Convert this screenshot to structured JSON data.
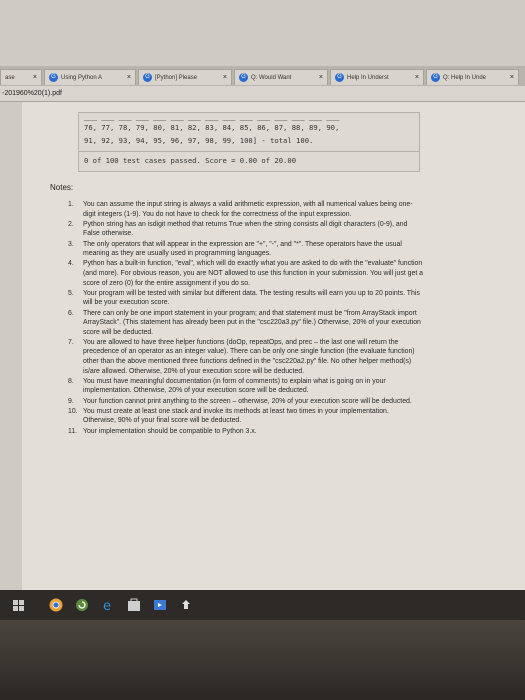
{
  "tabs": [
    {
      "label": "ase",
      "icon": "",
      "close": "×"
    },
    {
      "label": "Using Python A",
      "icon": "G",
      "close": "×"
    },
    {
      "label": "[Python] Please",
      "icon": "G",
      "close": "×"
    },
    {
      "label": "Q: Would Want",
      "icon": "G",
      "close": "×"
    },
    {
      "label": "Help In Underst",
      "icon": "G",
      "close": "×"
    },
    {
      "label": "Q: Help In Unde",
      "icon": "G",
      "close": "×"
    }
  ],
  "address": "-201960%20(1).pdf",
  "code": {
    "line1": "76, 77, 78, 79, 80, 81, 82, 83, 84, 85, 86, 87, 88, 89, 90,",
    "line2": "91, 92, 93, 94, 95, 96, 97, 98, 99, 100] - total 100.",
    "result": "0 of 100 test cases passed. Score = 0.00 of 20.00"
  },
  "notes_title": "Notes:",
  "notes": [
    {
      "num": "1.",
      "text": "You can assume the input string is always a valid arithmetic expression, with all numerical values being one-digit integers (1-9). You do not have to check for the correctness of the input expression."
    },
    {
      "num": "2.",
      "text": "Python string has an isdigit method that returns True when the string consists all digit characters (0-9), and False otherwise."
    },
    {
      "num": "3.",
      "text": "The only operators that will appear in the expression are \"+\", \"-\", and \"*\". These operators have the usual meaning as they are usually used in programming languages."
    },
    {
      "num": "4.",
      "text": "Python has a built-in function, \"eval\", which will do exactly what you are asked to do with the \"evaluate\" function (and more). For obvious reason, you are NOT allowed to use this function in your submission. You will just get a score of zero (0) for the entire assignment if you do so."
    },
    {
      "num": "5.",
      "text": "Your program will be tested with similar but different data. The testing results will earn you up to 20 points. This will be your execution score."
    },
    {
      "num": "6.",
      "text": "There can only be one import statement in your program; and that statement must be \"from ArrayStack import ArrayStack\". (This statement has already been put in the \"csc220a3.py\" file.) Otherwise, 20% of your execution score will be deducted."
    },
    {
      "num": "7.",
      "text": "You are allowed to have three helper functions (doOp, repeatOps, and prec – the last one will return the precedence of an operator as an integer value). There can be only one single function (the evaluate function) other than the above mentioned three functions defined in the \"csc220a2.py\" file. No other helper method(s) is/are allowed. Otherwise, 20% of your execution score will be deducted."
    },
    {
      "num": "8.",
      "text": "You must have meaningful documentation (in form of comments) to explain what is going on in your implementation. Otherwise, 20% of your execution score will be deducted."
    },
    {
      "num": "9.",
      "text": "Your function cannot print anything to the screen – otherwise, 20% of your execution score will be deducted."
    },
    {
      "num": "10.",
      "text": "You must create at least one stack and invoke its methods at least two times in your implementation. Otherwise, 90% of your final score will be deducted."
    },
    {
      "num": "11.",
      "text": "Your implementation should be compatible to Python 3.x."
    }
  ],
  "taskbar": {
    "start_icon": "windows-icon",
    "icons": [
      "chrome-icon",
      "refresh-icon",
      "edge-icon",
      "store-icon",
      "media-icon",
      "upload-icon"
    ],
    "colors": {
      "chrome": "#e8a23a",
      "edge": "#2f8fd8",
      "store": "#cfcfcf"
    }
  }
}
